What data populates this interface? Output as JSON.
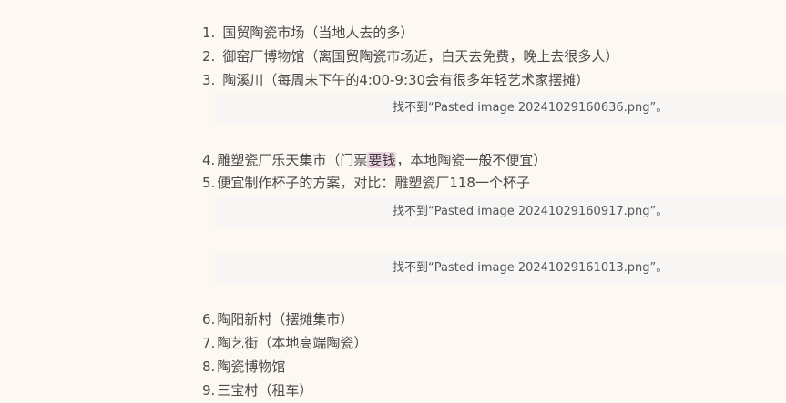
{
  "list": {
    "items": [
      {
        "num": "1.",
        "text": "国贸陶瓷市场（当地人去的多）"
      },
      {
        "num": "2.",
        "text": "御窑厂博物馆（离国贸陶瓷市场近，白天去免费，晚上去很多人）"
      },
      {
        "num": "3.",
        "text": "陶溪川（每周末下午的4:00-9:30会有很多年轻艺术家摆摊）"
      },
      {
        "num": "4.",
        "text_before": "雕塑瓷厂乐天集市（门票",
        "highlight": "要钱",
        "text_after": "，本地陶瓷一般不便宜）"
      },
      {
        "num": "5.",
        "text": "便宜制作杯子的方案，对比：雕塑瓷厂118一个杯子"
      },
      {
        "num": "6.",
        "text": "陶阳新村（摆摊集市）"
      },
      {
        "num": "7.",
        "text": "陶艺街（本地高端陶瓷）"
      },
      {
        "num": "8.",
        "text": "陶瓷博物馆"
      },
      {
        "num": "9.",
        "text": "三宝村（租车）"
      }
    ]
  },
  "embeds": [
    {
      "text": "找不到“Pasted image 20241029160636.png”。"
    },
    {
      "text": "找不到“Pasted image 20241029160917.png”。"
    },
    {
      "text": "找不到“Pasted image 20241029161013.png”。"
    }
  ]
}
